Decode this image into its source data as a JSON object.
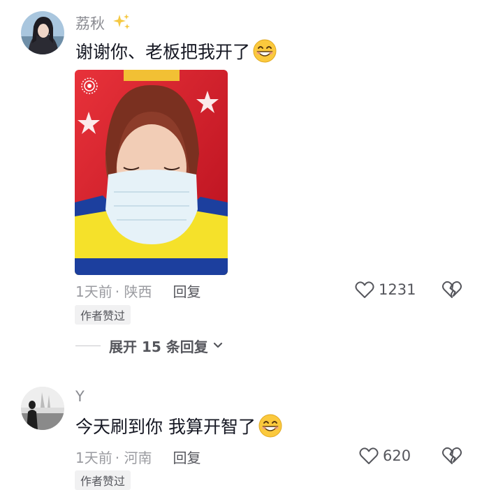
{
  "comments": [
    {
      "username": "荔秋",
      "text": "谢谢你、老板把我开了",
      "time": "1天前",
      "location": "· 陕西",
      "reply_label": "回复",
      "likes": "1231",
      "badge": "作者赞过",
      "expand_label": "展开 15 条回复"
    },
    {
      "username": "Y",
      "text": "今天刷到你 我算开智了",
      "time": "1天前",
      "location": "· 河南",
      "reply_label": "回复",
      "likes": "620",
      "badge": "作者赞过"
    }
  ],
  "icons": [
    "sparkle-icon",
    "grin-emoji-icon",
    "heart-icon",
    "broken-heart-icon",
    "chevron-down-icon",
    "live-photo-icon"
  ],
  "colors": {
    "secondary_text": "#8a8b91",
    "primary_text": "#161823",
    "badge_bg": "#f1f1f2"
  }
}
